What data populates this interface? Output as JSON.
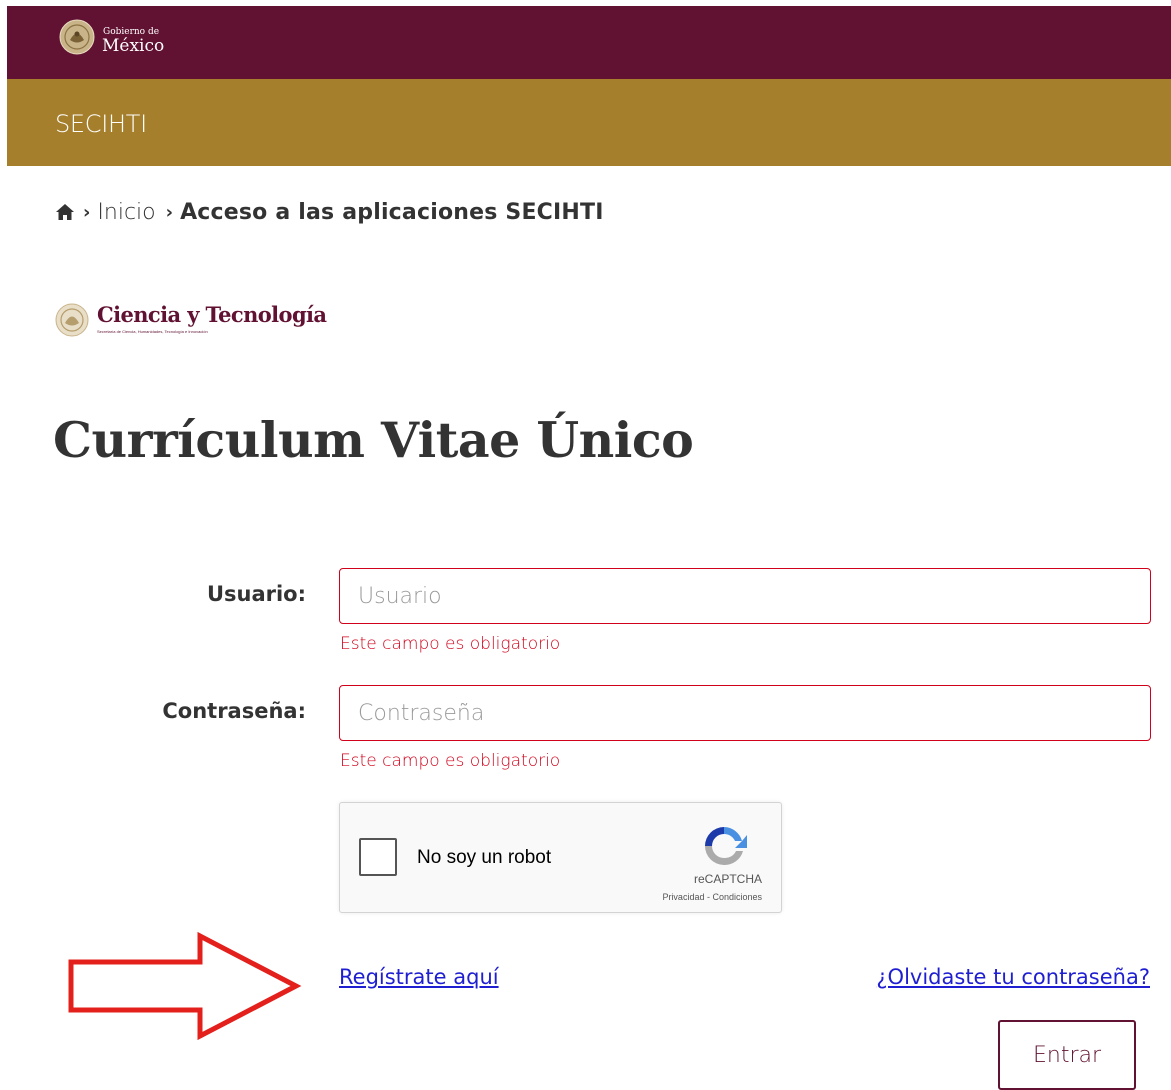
{
  "header": {
    "gov_small": "Gobierno de",
    "gov_big": "México",
    "subbar_title": "SECIHTI"
  },
  "breadcrumb": {
    "home_icon": "home-icon",
    "inicio": "Inicio",
    "current": "Acceso a las aplicaciones SECIHTI"
  },
  "logo": {
    "title": "Ciencia y Tecnología",
    "subtitle": "Secretaría de Ciencia, Humanidades, Tecnología e Innovación"
  },
  "page_title": "Currículum Vitae Único",
  "form": {
    "usuario_label": "Usuario:",
    "usuario_placeholder": "Usuario",
    "usuario_error": "Este campo es obligatorio",
    "password_label": "Contraseña:",
    "password_placeholder": "Contraseña",
    "password_error": "Este campo es obligatorio"
  },
  "recaptcha": {
    "label": "No soy un robot",
    "brand": "reCAPTCHA",
    "links": "Privacidad - Condiciones"
  },
  "links": {
    "register": "Regístrate aquí",
    "forgot": "¿Olvidaste tu contraseña?"
  },
  "submit_label": "Entrar",
  "colors": {
    "primary": "#611232",
    "secondary": "#a57f2c",
    "error": "#d0021b",
    "link": "#1f1fd1",
    "arrow": "#e3201b"
  }
}
